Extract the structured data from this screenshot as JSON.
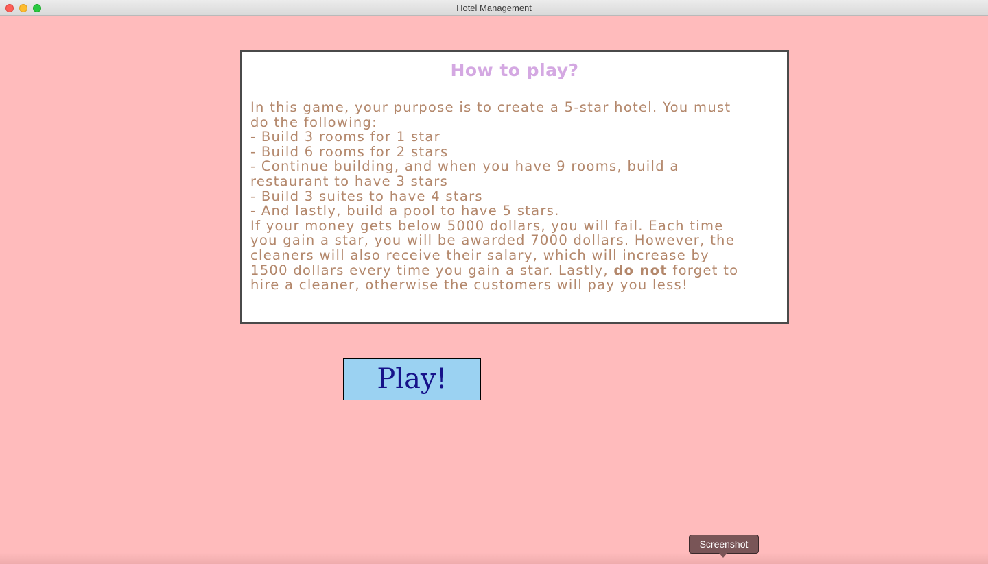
{
  "window": {
    "title": "Hotel Management"
  },
  "instructions": {
    "heading": "How to play?",
    "lines": [
      "In this game, your purpose is to create a 5-star hotel. You must",
      "do the following:",
      "- Build 3 rooms for 1 star",
      "- Build 6 rooms for 2 stars",
      "- Continue building, and when you have 9 rooms, build a",
      "restaurant to have 3 stars",
      "- Build 3 suites to have 4 stars",
      "- And lastly, build a pool to have 5 stars.",
      "If your money gets below 5000 dollars, you will fail. Each time",
      "you gain a star, you will be awarded 7000 dollars. However, the",
      "cleaners will also receive their salary, which will increase by",
      "1500 dollars every time you gain a star. Lastly,"
    ],
    "emphasis": "do not",
    "line_tail": "forget to",
    "last_line": "hire a cleaner, otherwise the customers will pay you less!"
  },
  "play_button": {
    "label": "Play!"
  },
  "tooltip": {
    "label": "Screenshot"
  },
  "colors": {
    "background": "#ffbbbc",
    "heading": "#d4a8e2",
    "body_text": "#b3876b",
    "button_fill": "#9bd2f2",
    "button_text": "#16128a"
  }
}
